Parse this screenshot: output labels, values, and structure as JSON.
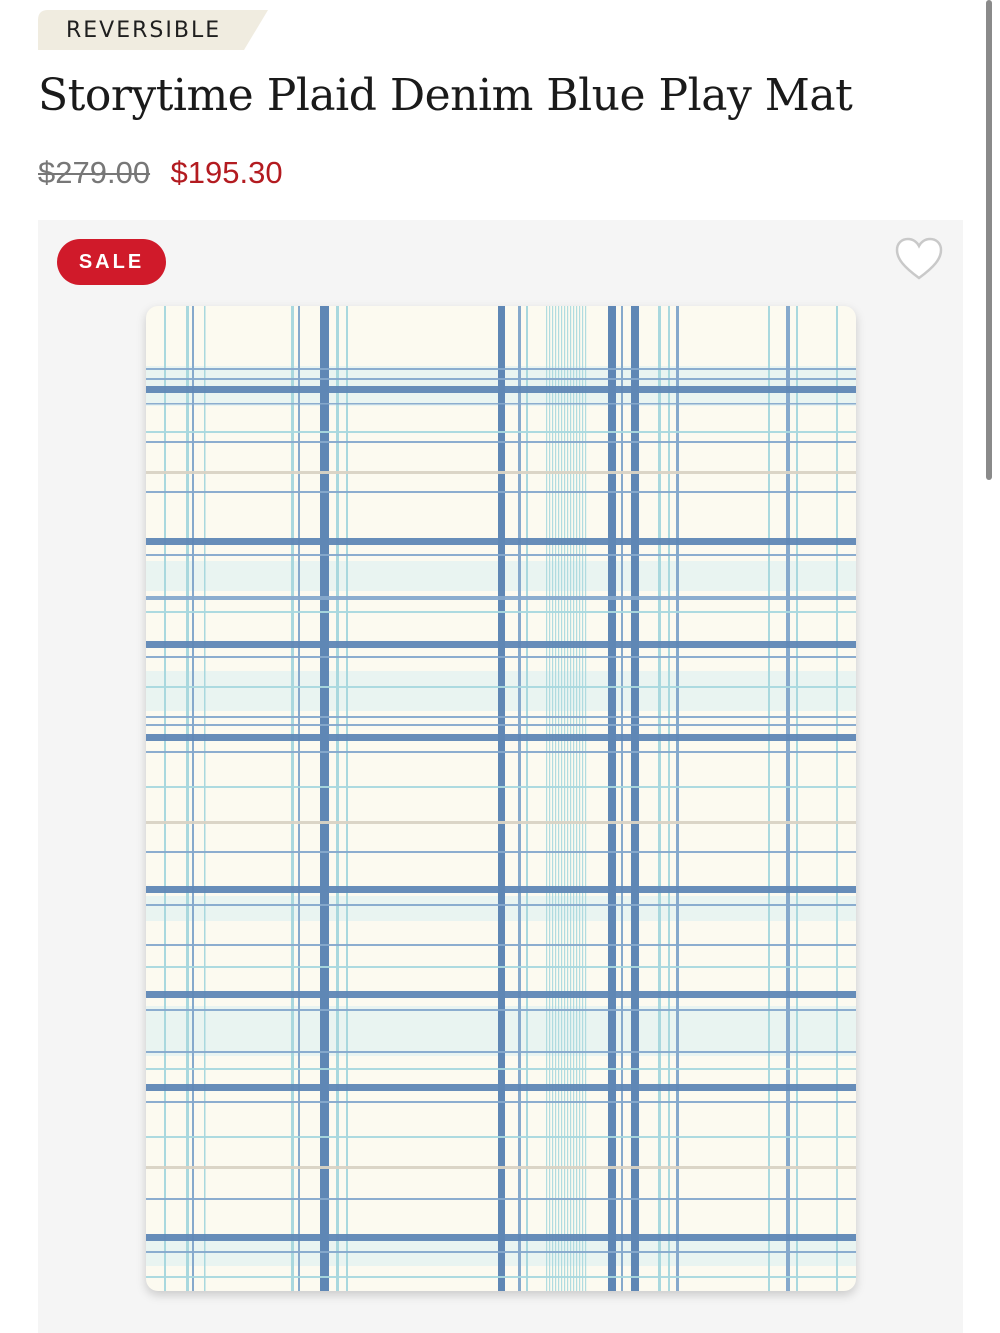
{
  "product": {
    "badge": "REVERSIBLE",
    "title": "Storytime Plaid Denim Blue Play Mat",
    "price_original": "$279.00",
    "price_sale": "$195.30"
  },
  "image_panel": {
    "sale_label": "SALE",
    "wishlist_icon": "heart-outline-icon",
    "image_alt": "Storytime Plaid Denim Blue Play Mat"
  },
  "colors": {
    "sale_red": "#d01a2a",
    "price_red": "#b31b20",
    "badge_bg": "#f0ece0",
    "denim_blue": "#5f87b5",
    "light_aqua": "#a9d8de",
    "mat_cream": "#fcfaf0"
  }
}
